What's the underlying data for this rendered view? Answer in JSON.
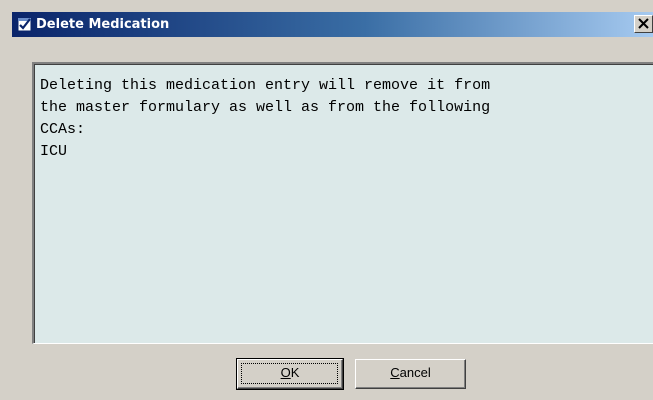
{
  "window": {
    "title": "Delete Medication",
    "close_label": "X"
  },
  "message": {
    "lines": [
      "Deleting this medication entry will remove it from",
      "the master formulary as well as from the following",
      "CCAs:",
      "ICU"
    ]
  },
  "buttons": {
    "ok_mnemonic": "O",
    "ok_rest": "K",
    "cancel_mnemonic": "C",
    "cancel_rest": "ancel"
  },
  "icons": {
    "title_icon": "checkmark-window-icon",
    "close_icon": "close-icon"
  },
  "colors": {
    "title_gradient_start": "#0a246a",
    "title_gradient_end": "#a6caf0",
    "message_background": "#dce9e9",
    "dialog_background": "#d4d0c8"
  }
}
